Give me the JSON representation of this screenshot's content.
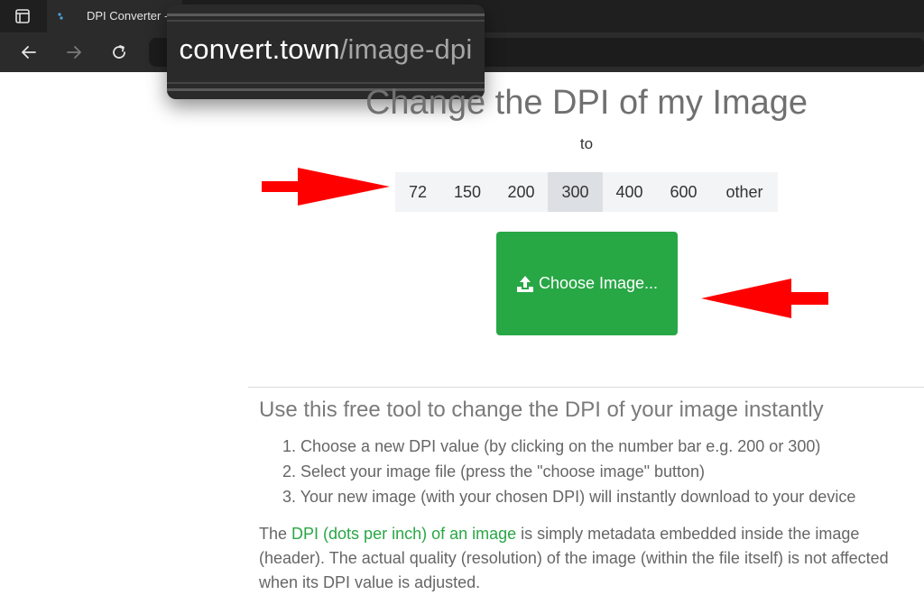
{
  "browser": {
    "tab_title": "DPI Converter -",
    "url_host": "convert.town",
    "url_path": "/image-dpi"
  },
  "page": {
    "title": "Change the DPI of my Image",
    "to_label": "to",
    "dpi_options": [
      "72",
      "150",
      "200",
      "300",
      "400",
      "600",
      "other"
    ],
    "selected_dpi": "300",
    "choose_button": "Choose Image...",
    "section_heading": "Use this free tool to change the DPI of your image instantly",
    "steps": [
      "1. Choose a new DPI value (by clicking on the number bar e.g. 200 or 300)",
      "2. Select your image file (press the \"choose image\" button)",
      "3. Your new image (with your chosen DPI) will instantly download to your device"
    ],
    "paragraph": {
      "prefix": "The ",
      "link": "DPI (dots per inch) of an image",
      "suffix": " is simply metadata embedded inside the image (header). The actual quality (resolution) of the image (within the file itself) is not affected when its DPI value is adjusted."
    }
  },
  "colors": {
    "accent_green": "#28a745",
    "annotation_red": "#ff0000"
  },
  "icons": [
    "tab-strip-icon",
    "back-icon",
    "forward-icon",
    "reload-icon",
    "upload-icon",
    "arrow-annotation-icon"
  ]
}
